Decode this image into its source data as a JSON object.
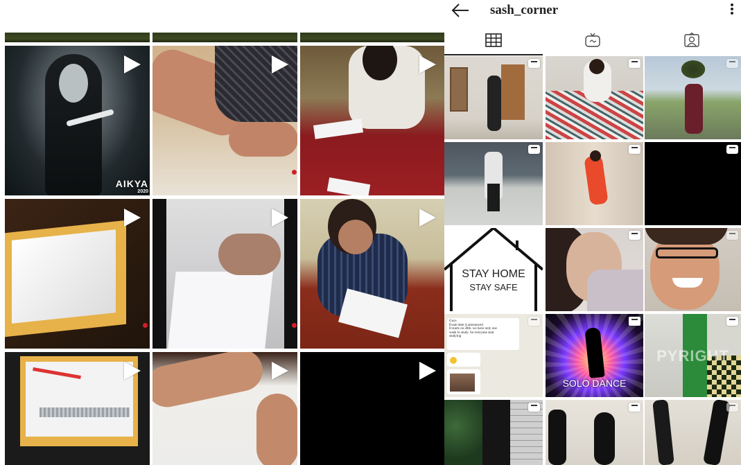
{
  "profile": {
    "username": "sash_corner",
    "back_icon": "arrow-left-icon",
    "more_icon": "vertical-dots-icon"
  },
  "tabs": [
    {
      "name": "grid",
      "icon": "grid-icon",
      "active": true
    },
    {
      "name": "igtv",
      "icon": "igtv-icon",
      "active": false
    },
    {
      "name": "tagged",
      "icon": "tagged-person-icon",
      "active": false
    }
  ],
  "left_grid": {
    "tiles": [
      {
        "desc": "girl-glasses-holding-brush",
        "badge": "AIKYA",
        "badge_year": "2020"
      },
      {
        "desc": "hand-placing-block"
      },
      {
        "desc": "girl-writing-at-table"
      },
      {
        "desc": "white-paper-on-table"
      },
      {
        "desc": "hands-cutting-paper"
      },
      {
        "desc": "girl-glasses-writing"
      },
      {
        "desc": "ruler-on-paper"
      },
      {
        "desc": "hand-on-paper"
      },
      {
        "desc": "black-tile"
      }
    ]
  },
  "right_grid": {
    "tiles": [
      {
        "desc": "person-standing-room"
      },
      {
        "desc": "girl-with-paper-collage"
      },
      {
        "desc": "man-on-rooftop"
      },
      {
        "desc": "boy-dancing-floor"
      },
      {
        "desc": "girl-dancing-red"
      },
      {
        "desc": "black-video"
      },
      {
        "desc": "stay-home-house",
        "line1": "STAY HOME",
        "line2": "STAY SAFE"
      },
      {
        "desc": "girl-face-smiling"
      },
      {
        "desc": "girl-glasses-smiling"
      },
      {
        "desc": "whatsapp-chat-screenshot",
        "chat_lines": [
          "Guys",
          "Exam date is announced",
          "It starts on 28th. we have only one",
          "week to study. So everyone start",
          "studying"
        ]
      },
      {
        "desc": "solo-dance-poster",
        "label": "SOLO DANCE"
      },
      {
        "desc": "copyright-checkered-floor",
        "watermark": "PYRIGHT"
      },
      {
        "desc": "plants-and-wall"
      },
      {
        "desc": "dancer-black-dress"
      },
      {
        "desc": "dancer-legs"
      }
    ]
  },
  "colors": {
    "text": "#222222",
    "play_icon": "#ffffff",
    "accent_red": "#d21f2b"
  }
}
